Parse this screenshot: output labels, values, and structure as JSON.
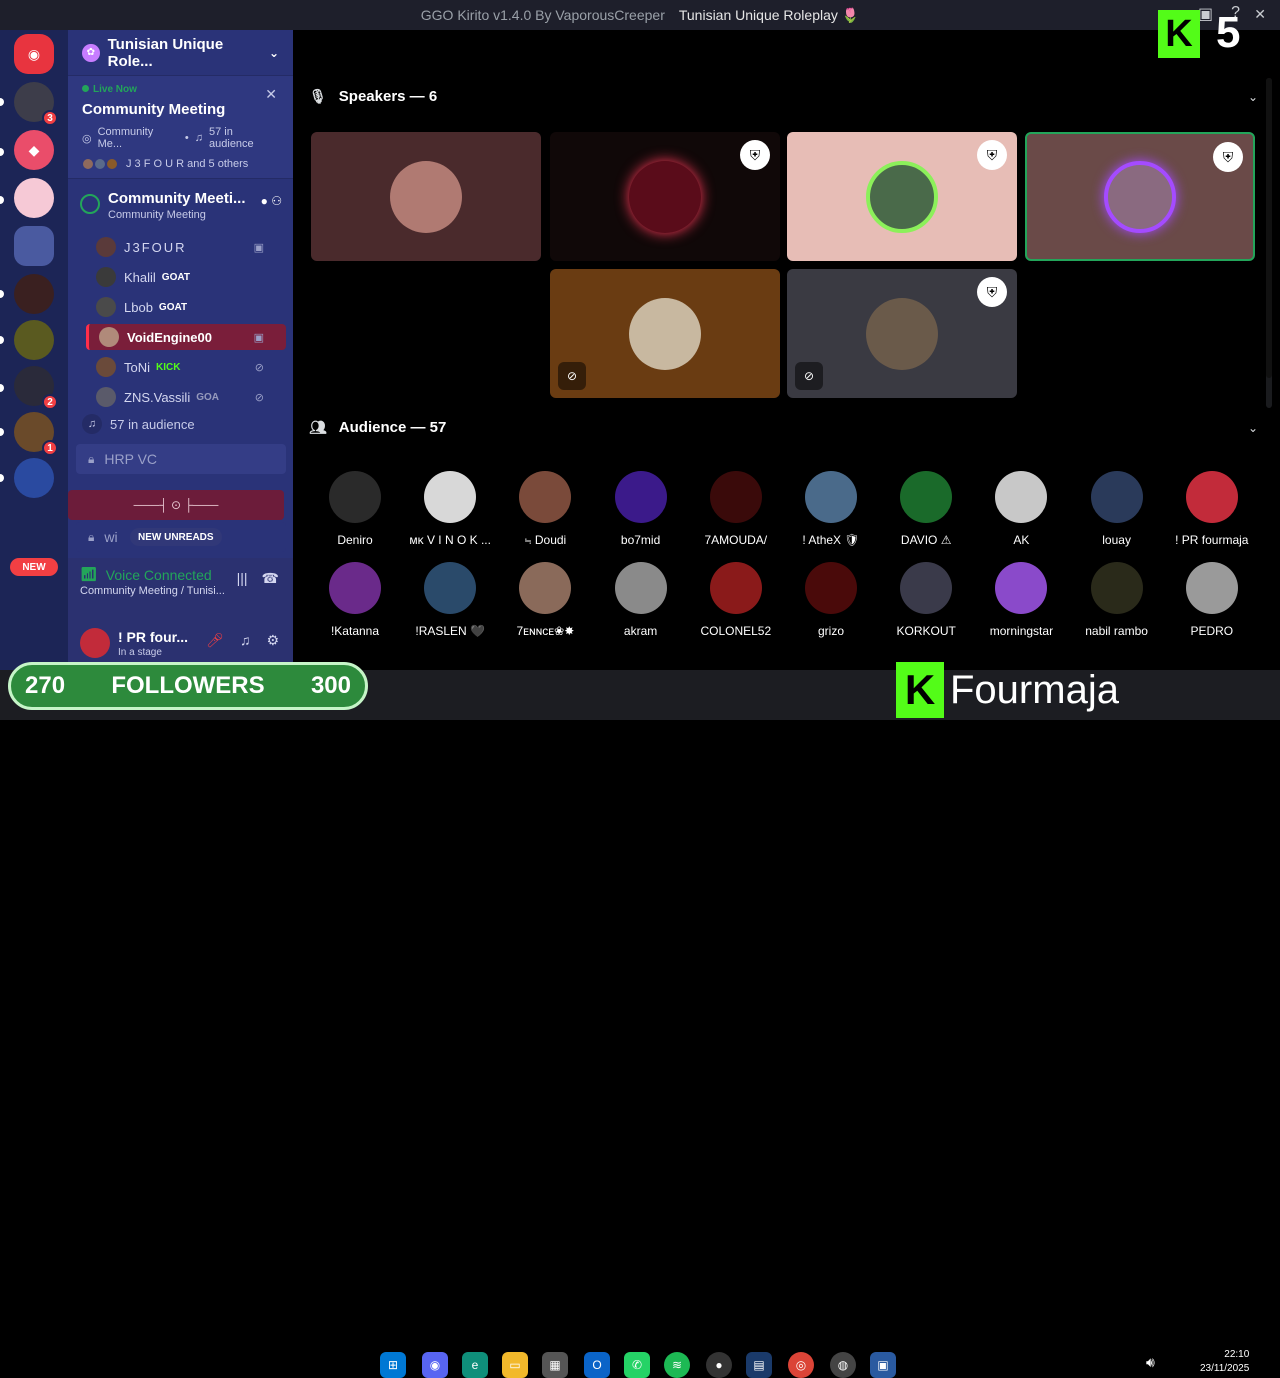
{
  "window": {
    "app_name": "GGO Kirito v1.4.0 By VaporousCreeper",
    "server_title": "Tunisian Unique Roleplay 🌷"
  },
  "server": {
    "name": "Tunisian Unique Role...",
    "live_now": "Live Now",
    "live_title": "Community Meeting",
    "live_channel": "Community Me...",
    "live_audience": "57 in audience",
    "live_people": "J 3 F O U R and 5 others"
  },
  "stage_channel": {
    "name": "Community Meeti...",
    "topic": "Community Meeting"
  },
  "speakers_list": [
    {
      "name": "J3FOUR",
      "tag": ""
    },
    {
      "name": "Khalil",
      "tag": "GOAT"
    },
    {
      "name": "Lbob",
      "tag": "GOAT"
    },
    {
      "name": "VoidEngine00",
      "tag": ""
    },
    {
      "name": "ToNi",
      "tag": "KICK"
    },
    {
      "name": "ZNS.Vassili",
      "tag": "GOA"
    }
  ],
  "audience_count_label": "57 in audience",
  "channels": {
    "hrp": "HRP VC",
    "wi": "wi",
    "new_unreads": "NEW UNREADS",
    "deco": "───┤ ⊙ ├───"
  },
  "voice": {
    "status": "Voice Connected",
    "location": "Community Meeting / Tunisi..."
  },
  "user": {
    "name": "! PR four...",
    "status": "In a stage"
  },
  "rail": {
    "new_label": "NEW",
    "badges": [
      "3",
      "2",
      "1"
    ]
  },
  "main": {
    "speakers_header": "Speakers — 6",
    "audience_header": "Audience — 57"
  },
  "audience": [
    {
      "name": "Deniro",
      "color": "#2a2a2a"
    },
    {
      "name": "ᴍᴋ V I N O K ...",
      "color": "#d8d8d8"
    },
    {
      "name": "⨫ Doudi",
      "color": "#7a4a3a"
    },
    {
      "name": "bo7mid",
      "color": "#3b1a8a"
    },
    {
      "name": "7AMOUDA/",
      "color": "#3a0a0a"
    },
    {
      "name": "! AtheX 🛡",
      "color": "#4a6a8a"
    },
    {
      "name": "DAVIO ⚠",
      "color": "#1a6a2a"
    },
    {
      "name": "AK",
      "color": "#c8c8c8"
    },
    {
      "name": "louay",
      "color": "#2a3a5a"
    },
    {
      "name": "! PR fourmaja",
      "color": "#c22b3a"
    },
    {
      "name": "!Katanna",
      "color": "#6a2a8a"
    },
    {
      "name": "!RASLEN 🖤",
      "color": "#2a4a6a"
    },
    {
      "name": "7ᴇɴɴᴄᴇ❀✸",
      "color": "#8a6a5a"
    },
    {
      "name": "akram",
      "color": "#8a8a8a"
    },
    {
      "name": "COLONEL52",
      "color": "#8a1a1a"
    },
    {
      "name": "grizo",
      "color": "#4a0a0a"
    },
    {
      "name": "KORKOUT",
      "color": "#3a3a4a"
    },
    {
      "name": "morningstar",
      "color": "#8a4aca"
    },
    {
      "name": "nabil rambo",
      "color": "#2a2a1a"
    },
    {
      "name": "PEDRO",
      "color": "#9a9a9a"
    }
  ],
  "overlay": {
    "kick_number": "5",
    "followers_current": "270",
    "followers_label": "FOLLOWERS",
    "followers_goal": "300",
    "brand_letter": "K",
    "brand_name": "Fourmaja",
    "time": "22:10",
    "date": "23/11/2025"
  },
  "colors": {
    "discord_green": "#23a55a",
    "kick_green": "#53fc18",
    "accent_red": "#f23f43"
  }
}
